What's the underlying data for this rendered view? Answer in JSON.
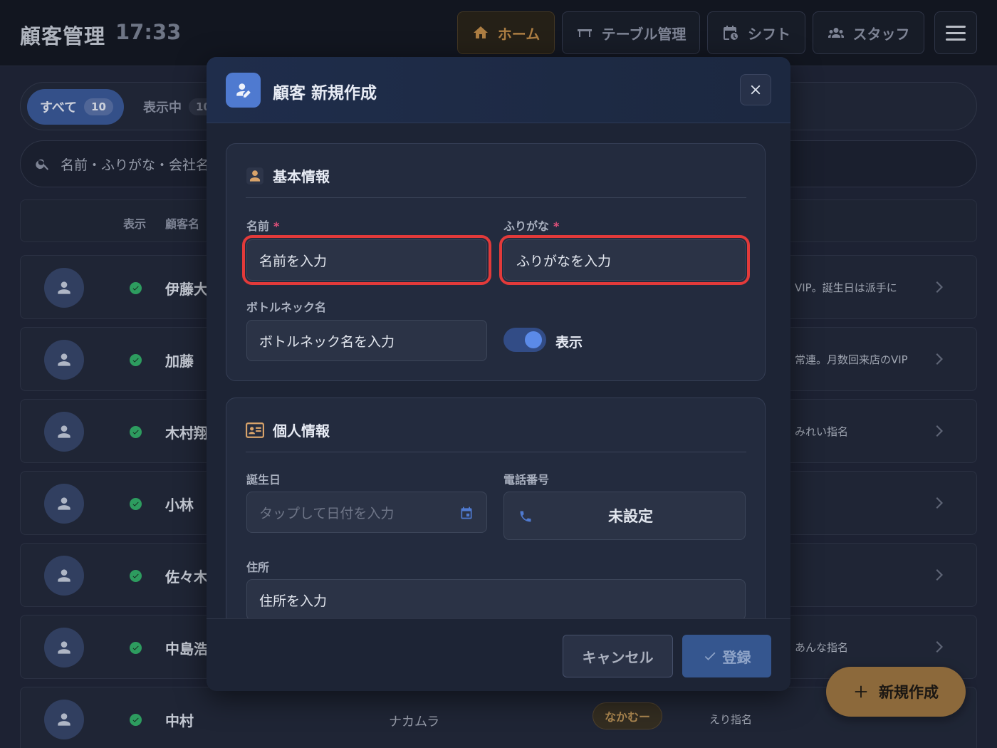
{
  "app": {
    "title": "顧客管理",
    "time": "17:33"
  },
  "nav": {
    "home": "ホーム",
    "tables": "テーブル管理",
    "shift": "シフト",
    "staff": "スタッフ"
  },
  "filters": {
    "all_label": "すべて",
    "all_count": "10",
    "shown_label": "表示中",
    "shown_count": "10"
  },
  "search": {
    "placeholder": "名前・ふりがな・会社名"
  },
  "table_header": {
    "shown": "表示",
    "name": "顧客名"
  },
  "rows": [
    {
      "name": "伊藤大",
      "note": "VIP。誕生日は派手に"
    },
    {
      "name": "加藤",
      "note": "常連。月数回来店のVIP"
    },
    {
      "name": "木村翔",
      "note": "みれい指名"
    },
    {
      "name": "小林",
      "note": ""
    },
    {
      "name": "佐々木",
      "note": ""
    },
    {
      "name": "中島浩",
      "note": "あんな指名"
    },
    {
      "name": "中村",
      "furigana": "ナカムラ",
      "nickname": "なかむー",
      "note": "えり指名"
    }
  ],
  "fab": {
    "label": "新規作成"
  },
  "modal": {
    "title": "顧客 新規作成",
    "basic": {
      "heading": "基本情報",
      "name_label": "名前",
      "name_placeholder": "名前を入力",
      "furigana_label": "ふりがな",
      "furigana_placeholder": "ふりがなを入力",
      "required_mark": "*",
      "bottle_label": "ボトルネック名",
      "bottle_placeholder": "ボトルネック名を入力",
      "visible_label": "表示",
      "visible_on": true
    },
    "personal": {
      "heading": "個人情報",
      "birthday_label": "誕生日",
      "birthday_placeholder": "タップして日付を入力",
      "phone_label": "電話番号",
      "phone_value": "未設定",
      "address_label": "住所",
      "address_placeholder": "住所を入力"
    },
    "cancel": "キャンセル",
    "save": "登録"
  },
  "colors": {
    "accent": "#4f7ad0",
    "brand_gold": "#c48f4a",
    "highlight": "#e23a3a",
    "success": "#33b16a"
  }
}
